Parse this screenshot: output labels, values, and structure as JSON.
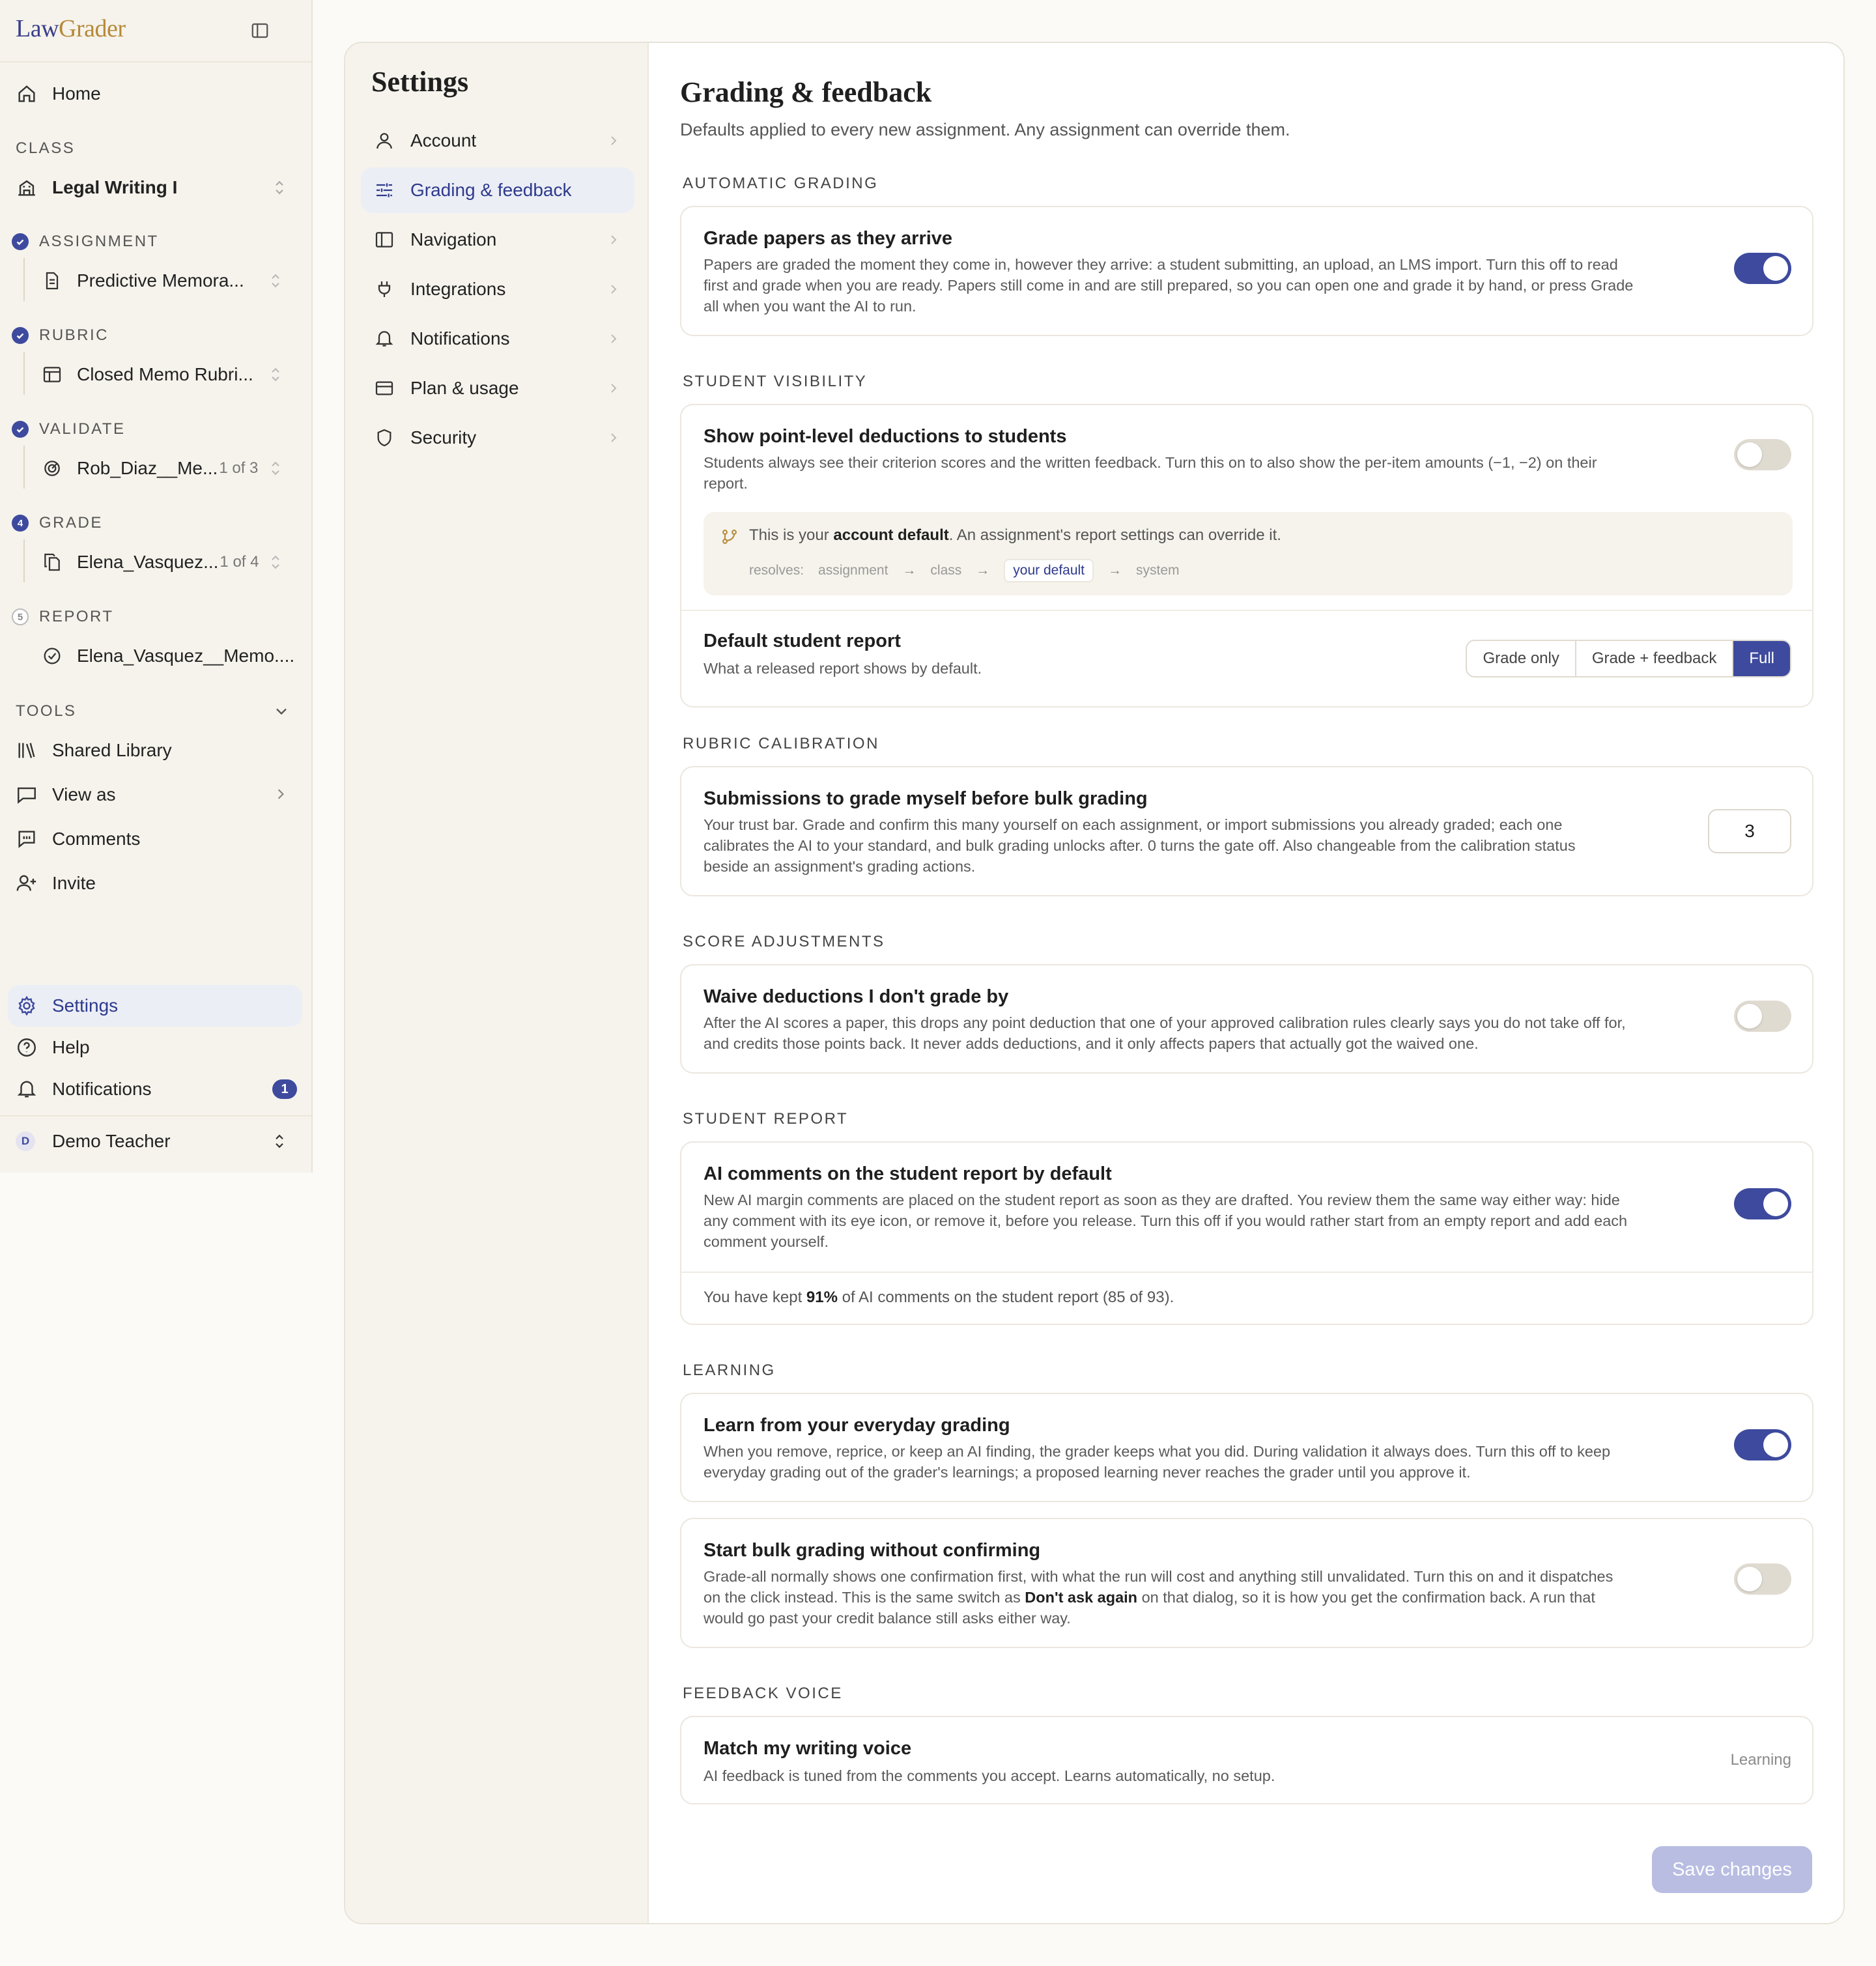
{
  "app": {
    "logo_law": "Law",
    "logo_grader": "Grader"
  },
  "sidebar": {
    "home": "Home",
    "class_label": "CLASS",
    "class_name": "Legal Writing I",
    "assignment_label": "ASSIGNMENT",
    "assignment_value": "Predictive Memora...",
    "rubric_label": "RUBRIC",
    "rubric_value": "Closed Memo Rubri...",
    "validate_label": "VALIDATE",
    "validate_value": "Rob_Diaz__Me...",
    "validate_count": "1 of 3",
    "grade_label": "GRADE",
    "grade_step": "4",
    "grade_value": "Elena_Vasquez...",
    "grade_count": "1 of 4",
    "report_label": "REPORT",
    "report_step": "5",
    "report_value": "Elena_Vasquez__Memo....",
    "tools_label": "TOOLS",
    "tools": [
      "Shared Library",
      "View as",
      "Comments",
      "Invite"
    ],
    "settings": "Settings",
    "help": "Help",
    "notifications": "Notifications",
    "notifications_count": "1",
    "user_initial": "D",
    "user_name": "Demo Teacher"
  },
  "settings_nav": {
    "title": "Settings",
    "items": [
      "Account",
      "Grading & feedback",
      "Navigation",
      "Integrations",
      "Notifications",
      "Plan & usage",
      "Security"
    ],
    "active_index": 1
  },
  "page": {
    "title": "Grading & feedback",
    "subtitle": "Defaults applied to every new assignment. Any assignment can override them."
  },
  "sections": {
    "automatic_grading": "AUTOMATIC GRADING",
    "student_visibility": "STUDENT VISIBILITY",
    "rubric_calibration": "RUBRIC CALIBRATION",
    "score_adjustments": "SCORE ADJUSTMENTS",
    "student_report": "STUDENT REPORT",
    "learning": "LEARNING",
    "feedback_voice": "FEEDBACK VOICE"
  },
  "settings": {
    "grade_on_arrival": {
      "title": "Grade papers as they arrive",
      "desc1": "Papers are graded the moment they come in, however they arrive: a student submitting, an upload, an LMS import. Turn this off to read",
      "desc2": "first and grade when you are ready. Papers still come in and are still prepared, so you can open one and grade it by hand, or press Grade",
      "desc3": "all when you want the AI to run.",
      "enabled": true
    },
    "point_deductions": {
      "title": "Show point-level deductions to students",
      "desc1": "Students always see their criterion scores and the written feedback. Turn this on to also show the per-item amounts (−1, −2) on their",
      "desc2": "report.",
      "enabled": false,
      "note_pre": "This is your ",
      "note_bold": "account default",
      "note_post": ". An assignment's report settings can override it.",
      "chain": [
        "resolves:",
        "assignment",
        "class",
        "your default",
        "system"
      ]
    },
    "default_report": {
      "title": "Default student report",
      "desc": "What a released report shows by default.",
      "options": [
        "Grade only",
        "Grade + feedback",
        "Full"
      ],
      "selected": "Full"
    },
    "calibration": {
      "title": "Submissions to grade myself before bulk grading",
      "desc1": "Your trust bar. Grade and confirm this many yourself on each assignment, or import submissions you already graded; each one",
      "desc2": "calibrates the AI to your standard, and bulk grading unlocks after. 0 turns the gate off. Also changeable from the calibration status",
      "desc3": "beside an assignment's grading actions.",
      "value": "3"
    },
    "waive": {
      "title": "Waive deductions I don't grade by",
      "desc1": "After the AI scores a paper, this drops any point deduction that one of your approved calibration rules clearly says you do not take off for,",
      "desc2": "and credits those points back. It never adds deductions, and it only affects papers that actually got the waived one.",
      "enabled": false
    },
    "ai_comments": {
      "title": "AI comments on the student report by default",
      "desc1": "New AI margin comments are placed on the student report as soon as they are drafted. You review them the same way either way: hide",
      "desc2": "any comment with its eye icon, or remove it, before you release. Turn this off if you would rather start from an empty report and add each",
      "desc3": "comment yourself.",
      "enabled": true,
      "stat_pre": "You have kept ",
      "stat_pct": "91%",
      "stat_post": " of AI comments on the student report (85 of 93)."
    },
    "learn_everyday": {
      "title": "Learn from your everyday grading",
      "desc1": "When you remove, reprice, or keep an AI finding, the grader keeps what you did. During validation it always does. Turn this off to keep",
      "desc2": "everyday grading out of the grader's learnings; a proposed learning never reaches the grader until you approve it.",
      "enabled": true
    },
    "bulk_no_confirm": {
      "title": "Start bulk grading without confirming",
      "desc1": "Grade-all normally shows one confirmation first, with what the run will cost and anything still unvalidated. Turn this on and it dispatches",
      "desc2a": "on the click instead. This is the same switch as ",
      "desc2b": "Don't ask again",
      "desc2c": " on that dialog, so it is how you get the confirmation back. A run that",
      "desc3": "would go past your credit balance still asks either way.",
      "enabled": false
    },
    "voice": {
      "title": "Match my writing voice",
      "desc": "AI feedback is tuned from the comments you accept. Learns automatically, no setup.",
      "status": "Learning"
    }
  },
  "actions": {
    "save": "Save changes"
  },
  "colors": {
    "accent": "#3d4a9e",
    "brand_gold": "#b58a3a",
    "toggle_off": "#e0dbd1"
  }
}
